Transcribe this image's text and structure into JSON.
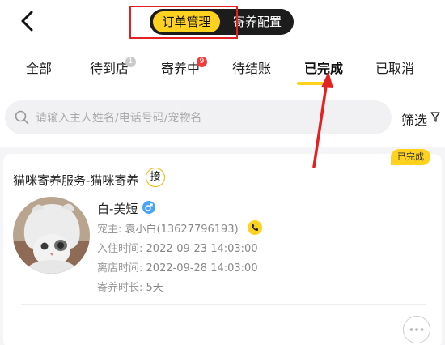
{
  "header": {
    "back_icon": "chevron-left-icon",
    "segments": [
      "订单管理",
      "寄养配置"
    ],
    "active_segment": "订单管理"
  },
  "tabs": [
    {
      "label": "全部",
      "badge": ""
    },
    {
      "label": "待到店",
      "badge": "1"
    },
    {
      "label": "寄养中",
      "badge": "9"
    },
    {
      "label": "待结账",
      "badge": ""
    },
    {
      "label": "已完成",
      "badge": ""
    },
    {
      "label": "已取消",
      "badge": ""
    }
  ],
  "active_tab": "已完成",
  "search": {
    "placeholder": "请输入主人姓名/电话号码/宠物名",
    "filter_label": "筛选"
  },
  "order": {
    "status": "已完成",
    "service": "猫咪寄养服务-猫咪寄养",
    "accept_label": "接",
    "pet_name": "白-美短",
    "owner_label": "宠主:",
    "owner_value": "袁小白(13627796193)",
    "checkin_label": "入住时间:",
    "checkin_value": "2022-09-23 14:03:00",
    "checkout_label": "离店时间:",
    "checkout_value": "2022-09-28 14:03:00",
    "duration_label": "寄养时长:",
    "duration_value": "5天"
  },
  "colors": {
    "accent": "#ffd21f",
    "annotation_red": "#e52020",
    "badge_red": "#f03c3c"
  }
}
